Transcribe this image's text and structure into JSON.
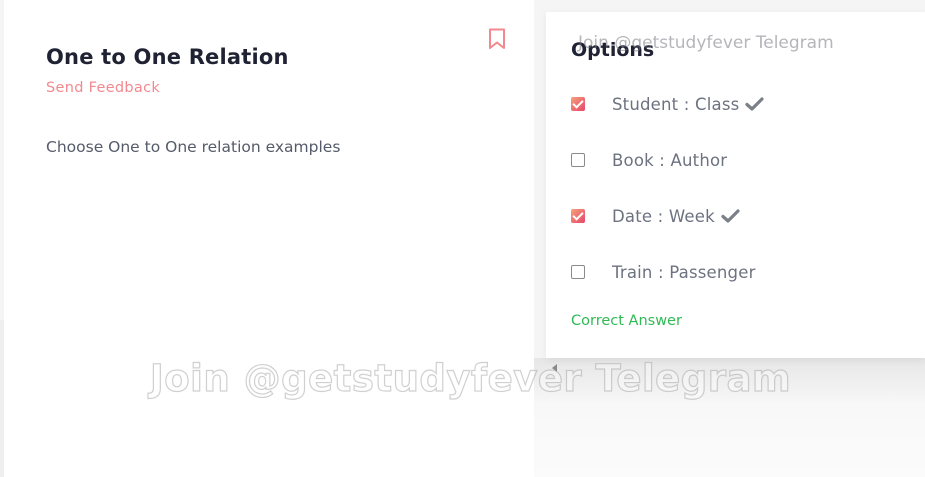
{
  "question": {
    "title": "One to One Relation",
    "feedback_label": "Send Feedback",
    "text": "Choose One to One relation examples",
    "bookmark_icon": "bookmark-icon"
  },
  "options_panel": {
    "title": "Options",
    "items": [
      {
        "label": "Student : Class",
        "checked": true,
        "correct": true
      },
      {
        "label": "Book : Author",
        "checked": false,
        "correct": false
      },
      {
        "label": "Date : Week",
        "checked": true,
        "correct": true
      },
      {
        "label": "Train : Passenger",
        "checked": false,
        "correct": false
      }
    ],
    "correct_answer_label": "Correct Answer"
  },
  "watermarks": {
    "small": "Join @getstudyfever Telegram",
    "large": "Join @getstudyfever Telegram"
  },
  "colors": {
    "accent": "#f2898f",
    "correct": "#2fba55",
    "title": "#1f2233",
    "checkbox_gradient_start": "#f6a07a",
    "checkbox_gradient_end": "#e8456a"
  }
}
